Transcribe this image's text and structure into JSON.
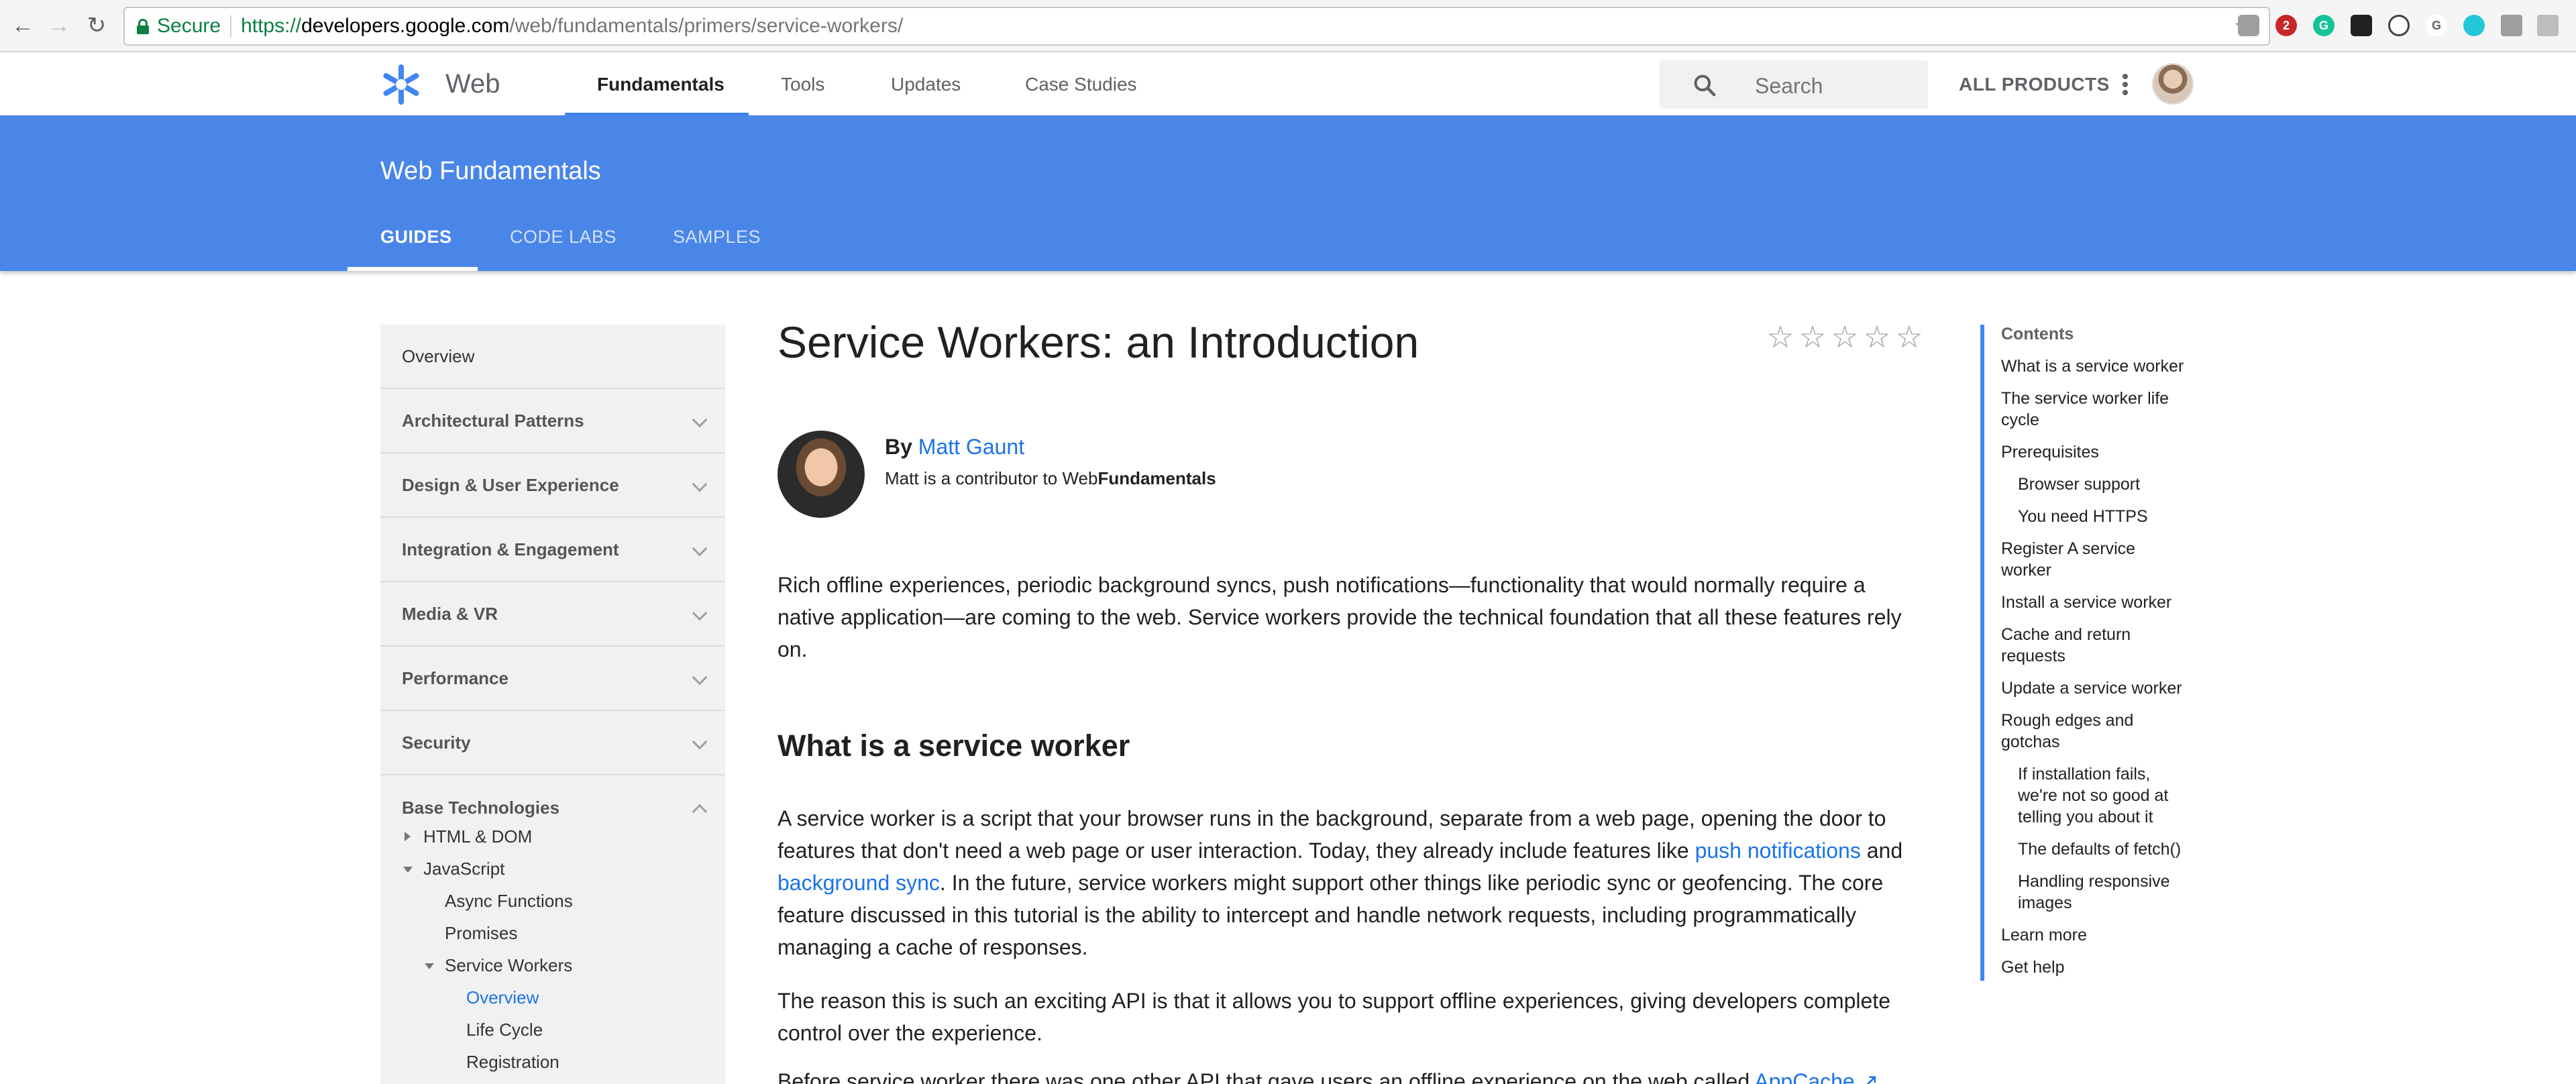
{
  "browser": {
    "url": {
      "scheme": "https://",
      "host": "developers.google.com",
      "path": "/web/fundamentals/primers/service-workers/"
    },
    "secure_label": "Secure",
    "extension_badge": "2"
  },
  "header": {
    "brand": "Web",
    "nav": [
      "Fundamentals",
      "Tools",
      "Updates",
      "Case Studies"
    ],
    "search_placeholder": "Search",
    "all_products": "ALL PRODUCTS"
  },
  "banner": {
    "title": "Web Fundamentals",
    "tabs": [
      "GUIDES",
      "CODE LABS",
      "SAMPLES"
    ]
  },
  "sidebar": {
    "overview": "Overview",
    "sections": [
      "Architectural Patterns",
      "Design & User Experience",
      "Integration & Engagement",
      "Media & VR",
      "Performance",
      "Security"
    ],
    "expanded_section": "Base Technologies",
    "tree": {
      "html_dom": "HTML & DOM",
      "javascript": "JavaScript",
      "async_functions": "Async Functions",
      "promises": "Promises",
      "service_workers": "Service Workers",
      "overview": "Overview",
      "life_cycle": "Life Cycle",
      "registration": "Registration"
    }
  },
  "article": {
    "title": "Service Workers: an Introduction",
    "rating_stars": 5,
    "author": {
      "by": "By",
      "name": "Matt Gaunt",
      "contrib_prefix": "Matt is a contributor to Web",
      "contrib_bold": "Fundamentals"
    },
    "intro": "Rich offline experiences, periodic background syncs, push notifications—functionality that would normally require a native application—are coming to the web. Service workers provide the technical foundation that all these features rely on.",
    "h2": "What is a service worker",
    "p1": {
      "a": "A service worker is a script that your browser runs in the background, separate from a web page, opening the door to features that don't need a web page or user interaction. Today, they already include features like ",
      "link1": "push notifications",
      "b": " and ",
      "link2": "background sync",
      "c": ". In the future, service workers might support other things like periodic sync or geofencing. The core feature discussed in this tutorial is the ability to intercept and handle network requests, including programmatically managing a cache of responses."
    },
    "p2": "The reason this is such an exciting API is that it allows you to support offline experiences, giving developers complete control over the experience.",
    "p3": {
      "a": "Before service worker there was one other API that gave users an offline experience on the web called ",
      "link": "AppCache"
    }
  },
  "toc": {
    "heading": "Contents",
    "items": [
      "What is a service worker",
      "The service worker life cycle",
      "Prerequisites",
      "Browser support",
      "You need HTTPS",
      "Register A service worker",
      "Install a service worker",
      "Cache and return requests",
      "Update a service worker",
      "Rough edges and gotchas",
      "If installation fails, we're not so good at telling you about it",
      "The defaults of fetch()",
      "Handling responsive images",
      "Learn more",
      "Get help"
    ]
  },
  "colors": {
    "banner": "#4a86e8",
    "accent": "#4285f4",
    "link": "#1a73e8",
    "secure_green": "#0b8043"
  }
}
